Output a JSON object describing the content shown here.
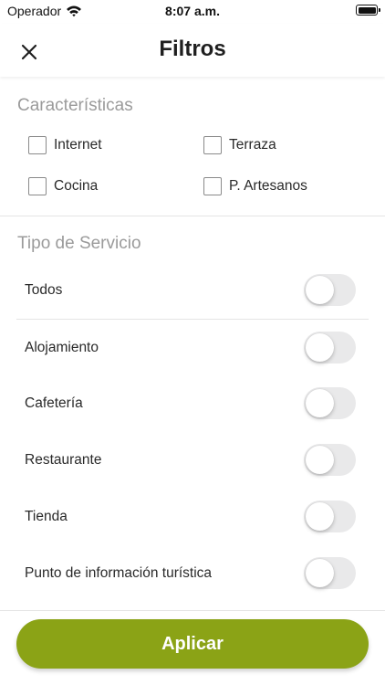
{
  "status_bar": {
    "carrier": "Operador",
    "time": "8:07 a.m.",
    "icons": [
      "wifi-icon",
      "battery-icon"
    ]
  },
  "header": {
    "title": "Filtros",
    "close_icon": "close-icon"
  },
  "characteristics": {
    "title": "Características",
    "items": [
      {
        "label": "Internet",
        "checked": false
      },
      {
        "label": "Terraza",
        "checked": false
      },
      {
        "label": "Cocina",
        "checked": false
      },
      {
        "label": "P. Artesanos",
        "checked": false
      }
    ]
  },
  "service_type": {
    "title": "Tipo de Servicio",
    "items": [
      {
        "label": "Todos",
        "on": false
      },
      {
        "label": "Alojamiento",
        "on": false
      },
      {
        "label": "Cafetería",
        "on": false
      },
      {
        "label": "Restaurante",
        "on": false
      },
      {
        "label": "Tienda",
        "on": false
      },
      {
        "label": "Punto de información turística",
        "on": false
      }
    ]
  },
  "apply_button": {
    "label": "Aplicar"
  },
  "colors": {
    "accent": "#8ba316",
    "toggle_off": "#e9e9ea",
    "section_title": "#9b9b9b"
  }
}
